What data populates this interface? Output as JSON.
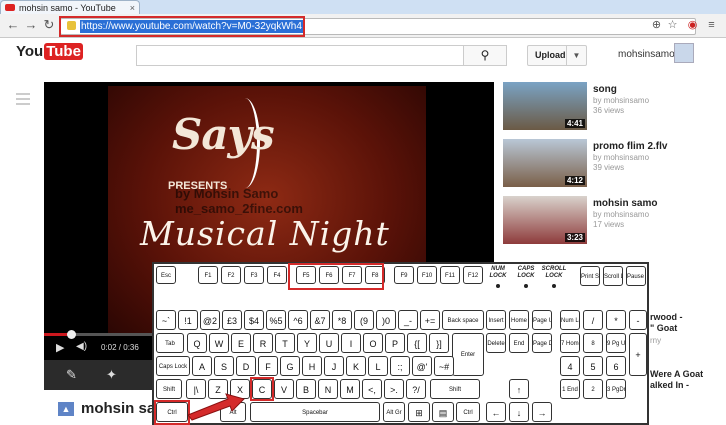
{
  "browser": {
    "tab_title": "mohsin samo - YouTube",
    "tab_close": "×",
    "url": "https://www.youtube.com/watch?v=M0-32yqkWh4",
    "back_icon": "left-arrow",
    "forward_icon": "right-arrow",
    "reload_icon": "reload"
  },
  "header": {
    "logo_you": "You",
    "logo_tube": "Tube",
    "search_placeholder": "",
    "upload_label": "Upload",
    "username": "mohsinsamo"
  },
  "video": {
    "frame_says": "Says",
    "frame_presents": "PRESENTS",
    "frame_watermark": "by Mohsin Samo\nme_samo_2fine.com",
    "frame_title": "Musical Night",
    "time": "0:02 / 0:36",
    "channel_title": "mohsin samo",
    "progress": 0.06
  },
  "sidebar": {
    "items": [
      {
        "title": "song",
        "by": "by mohsinsamo",
        "views": "36 views",
        "duration": "4:41"
      },
      {
        "title": "promo flim 2.flv",
        "by": "by mohsinsamo",
        "views": "39 views",
        "duration": "4:12"
      },
      {
        "title": "mohsin samo",
        "by": "by mohsinsamo",
        "views": "17 views",
        "duration": "3:23"
      }
    ],
    "peek_1": "rwood -",
    "peek_2": "\" Goat",
    "peek_3": "rny",
    "peek_4": "Were A Goat",
    "peek_5": "alked In -"
  },
  "keyboard": {
    "esc": "Esc",
    "f_keys": [
      "F1",
      "F2",
      "F3",
      "F4",
      "F5",
      "F6",
      "F7",
      "F8",
      "F9",
      "F10",
      "F11",
      "F12"
    ],
    "leds": [
      "NUM LOCK",
      "CAPS LOCK",
      "SCROLL LOCK"
    ],
    "prtsc": "Print Screen",
    "scroll_lock": "Scroll Lock",
    "pause": "Pause Break",
    "num_row": [
      "~`",
      "!1",
      "@2",
      "£3",
      "$4",
      "%5",
      "^6",
      "&7",
      "*8",
      "(9",
      ")0",
      "_-",
      "+="
    ],
    "backspace": "Back space",
    "tab": "Tab",
    "q_row": [
      "Q",
      "W",
      "E",
      "R",
      "T",
      "Y",
      "U",
      "I",
      "O",
      "P",
      "{[",
      "}]"
    ],
    "enter": "Enter",
    "caps": "Caps Lock",
    "a_row": [
      "A",
      "S",
      "D",
      "F",
      "G",
      "H",
      "J",
      "K",
      "L",
      ":;",
      "@'",
      "~#"
    ],
    "shift": "Shift",
    "z_row": [
      "|\\",
      "Z",
      "X",
      "C",
      "V",
      "B",
      "N",
      "M",
      "<,",
      ">.",
      "?/"
    ],
    "ctrl": "Ctrl",
    "alt": "Alt",
    "spacebar": "Spacebar",
    "altgr": "Alt Gr",
    "ins": "Insert",
    "home": "Home",
    "pgup": "Page Up",
    "del": "Delete",
    "end": "End",
    "pgdn": "Page Down",
    "numlock": "Num Lock",
    "np_div": "/",
    "np_mul": "*",
    "np_minus": "-",
    "np_row1": [
      "7 Home",
      "8",
      "9 Pg Up"
    ],
    "np_plus": "+",
    "np_row2": [
      "4",
      "5",
      "6"
    ],
    "np_row3": [
      "1 End",
      "2",
      "3 PgDn"
    ],
    "highlight_color": "#d42a2a"
  }
}
